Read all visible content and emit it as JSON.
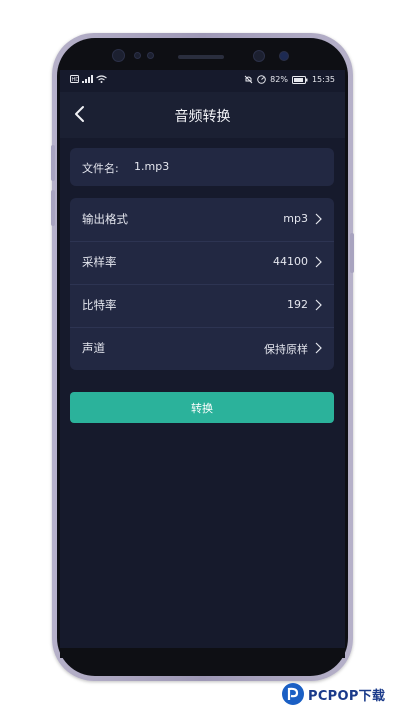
{
  "status_bar": {
    "battery_percent": "82%",
    "time": "15:35",
    "left_icons": [
      "hd-icon",
      "signal-icon",
      "wifi-icon"
    ],
    "right_icons": [
      "mute-icon",
      "speed-icon",
      "battery-icon"
    ]
  },
  "nav": {
    "title": "音频转换",
    "back_icon": "chevron-left-icon"
  },
  "file": {
    "label": "文件名:",
    "value": "1.mp3"
  },
  "options": [
    {
      "label": "输出格式",
      "value": "mp3"
    },
    {
      "label": "采样率",
      "value": "44100"
    },
    {
      "label": "比特率",
      "value": "192"
    },
    {
      "label": "声道",
      "value": "保持原样"
    }
  ],
  "convert_button": {
    "label": "转换"
  },
  "watermark": {
    "text": "PCPOP下载"
  },
  "colors": {
    "background": "#161a2c",
    "card": "#222842",
    "nav": "#1b2033",
    "accent": "#2bb29b",
    "frame": "#a8a3bf"
  }
}
